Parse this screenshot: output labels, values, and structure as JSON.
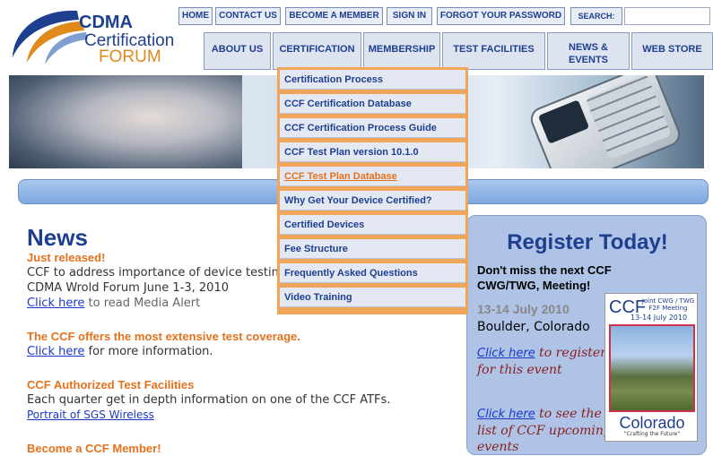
{
  "logo": {
    "line1": "CDMA",
    "line2": "Certification",
    "line3": "FORUM"
  },
  "utility_nav": [
    "HOME",
    "CONTACT US",
    "BECOME A MEMBER",
    "SIGN IN",
    "FORGOT YOUR PASSWORD"
  ],
  "search": {
    "label": "SEARCH:",
    "value": ""
  },
  "main_nav": [
    "ABOUT US",
    "CERTIFICATION",
    "MEMBERSHIP",
    "TEST FACILITIES",
    "NEWS & EVENTS",
    "WEB STORE"
  ],
  "dropdown": {
    "active_item": "CCF Test Plan Database",
    "items": [
      "Certification Process",
      "CCF Certification Database",
      "CCF Certification Process Guide",
      "CCF Test Plan version 10.1.0",
      "CCF Test Plan Database",
      "Why Get Your Device Certified?",
      "Certified Devices",
      "Fee Structure",
      "Frequently Asked Questions",
      "Video Training"
    ]
  },
  "news": {
    "title": "News",
    "just_released": "Just released!",
    "item1_text": "CCF to address importance of device testing",
    "item1_text2": "CDMA Wrold Forum June 1-3, 2010",
    "item1_link": "Click here",
    "item1_after": " to read Media Alert",
    "heading2": "The CCF offers the most extensive test coverage.",
    "item2_link": "Click here",
    "item2_after": " for more information.",
    "heading3": "CCF Authorized Test Facilities",
    "item3_text": "Each quarter get in depth information on one of the CCF ATFs.",
    "item3_link": "Portrait of SGS Wireless",
    "heading4": "Become a CCF Member!"
  },
  "register": {
    "title": "Register Today!",
    "subtitle": "Don't miss the next CCF CWG/TWG, Meeting!",
    "date": "13-14 July 2010",
    "place": "Boulder, Colorado",
    "link1": "Click here",
    "link1_after": " to register for this event",
    "link2": "Click here",
    "link2_after": " to see the list of CCF upcoming events"
  },
  "promo": {
    "ccf": "CCF",
    "joint": "Joint CWG / TWG F2F Meeting",
    "date": "13-14 July 2010",
    "colorado": "Colorado",
    "tagline": "\"Crafting the Future\""
  },
  "colors": {
    "brand_blue": "#1e3f8f",
    "accent_orange": "#e6711c",
    "dropdown_orange": "#f1a559",
    "panel_blue": "#aec3e6"
  }
}
